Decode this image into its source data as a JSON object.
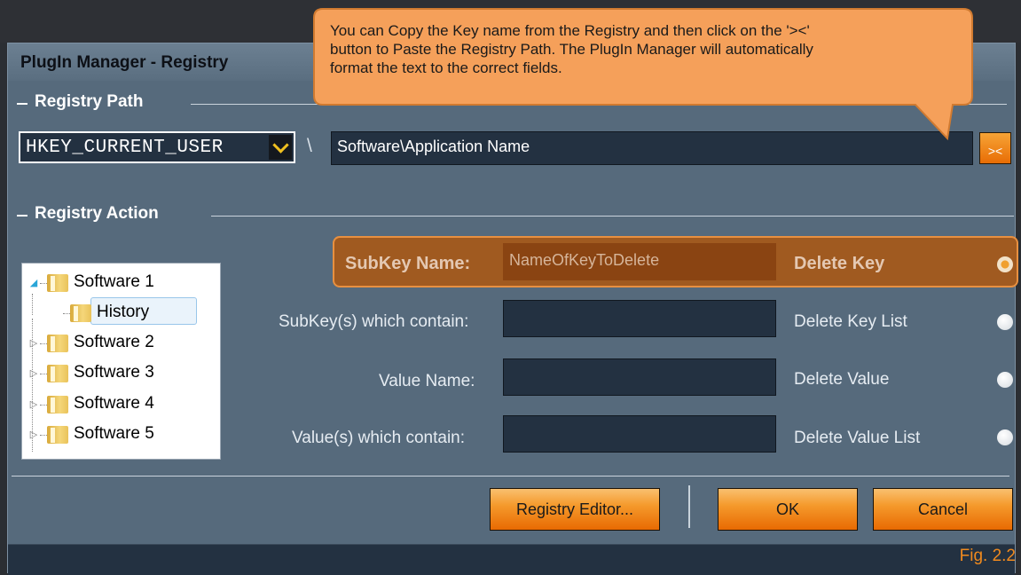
{
  "window": {
    "title": "PlugIn Manager - Registry"
  },
  "tooltip": {
    "lines": [
      "You can Copy the Key name from the Registry and then click on the '><'",
      "button to Paste the Registry Path. The PlugIn Manager will automatically",
      "format the text to the correct fields."
    ]
  },
  "registry_path": {
    "section_label": "Registry Path",
    "hive": "HKEY_CURRENT_USER",
    "separator": "\\",
    "path": "Software\\Application Name",
    "paste_label": "><"
  },
  "registry_action": {
    "section_label": "Registry Action",
    "tree": [
      {
        "label": "Software 1",
        "expanded": true
      },
      {
        "label": "History",
        "selected": true
      },
      {
        "label": "Software 2"
      },
      {
        "label": "Software 3"
      },
      {
        "label": "Software 4"
      },
      {
        "label": "Software 5"
      }
    ],
    "rows": [
      {
        "label": "SubKey Name:",
        "value": "NameOfKeyToDelete",
        "action": "Delete Key",
        "selected": true
      },
      {
        "label": "SubKey(s) which contain:",
        "value": "",
        "action": "Delete Key List",
        "selected": false
      },
      {
        "label": "Value Name:",
        "value": "",
        "action": "Delete Value",
        "selected": false
      },
      {
        "label": "Value(s) which contain:",
        "value": "",
        "action": "Delete Value List",
        "selected": false
      }
    ]
  },
  "buttons": {
    "registry_editor": "Registry Editor...",
    "ok": "OK",
    "cancel": "Cancel"
  },
  "figure_label": "Fig. 2.2",
  "colors": {
    "accent": "#f08a1e",
    "panel": "#566a7c",
    "field": "#233141"
  }
}
